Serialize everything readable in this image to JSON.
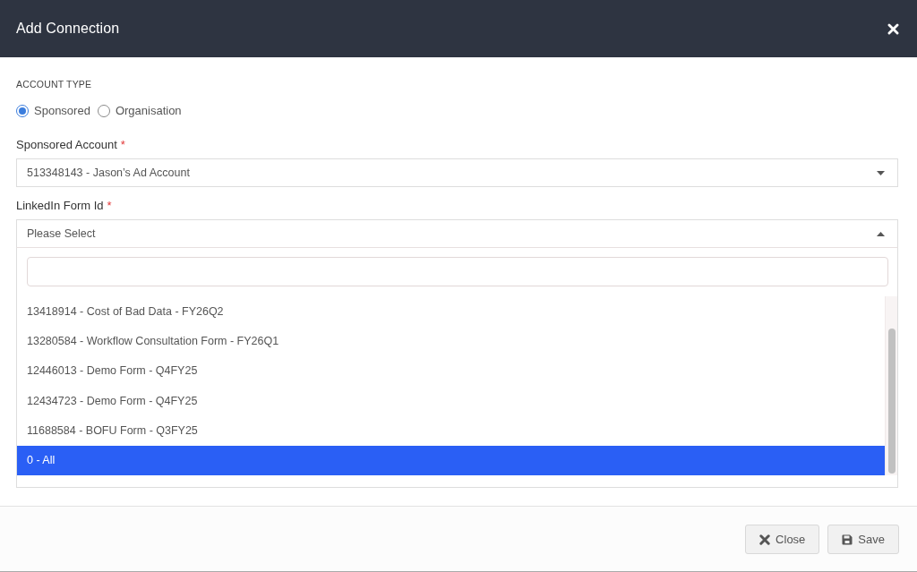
{
  "dialog": {
    "title": "Add Connection"
  },
  "account_type": {
    "label": "ACCOUNT TYPE",
    "options": [
      {
        "label": "Sponsored",
        "selected": true
      },
      {
        "label": "Organisation",
        "selected": false
      }
    ]
  },
  "fields": [
    {
      "label": "Sponsored Account",
      "required_mark": "*",
      "value": "513348143 - Jason’s Ad Account",
      "expanded": false
    },
    {
      "label": "LinkedIn Form Id",
      "required_mark": "*",
      "value": "Please Select",
      "expanded": true,
      "dropdown": {
        "options": [
          {
            "label": "13418914 - Cost of Bad Data - FY26Q2",
            "selected": false
          },
          {
            "label": "13280584 - Workflow Consultation Form - FY26Q1",
            "selected": false
          },
          {
            "label": "12446013 - Demo Form - Q4FY25",
            "selected": false
          },
          {
            "label": "12434723 - Demo Form - Q4FY25",
            "selected": false
          },
          {
            "label": "11688584 - BOFU Form - Q3FY25",
            "selected": false
          },
          {
            "label": "0 - All",
            "selected": true
          }
        ]
      }
    }
  ],
  "buttons": [
    {
      "kind": "close",
      "label": "Close"
    },
    {
      "kind": "save",
      "label": "Save"
    }
  ]
}
